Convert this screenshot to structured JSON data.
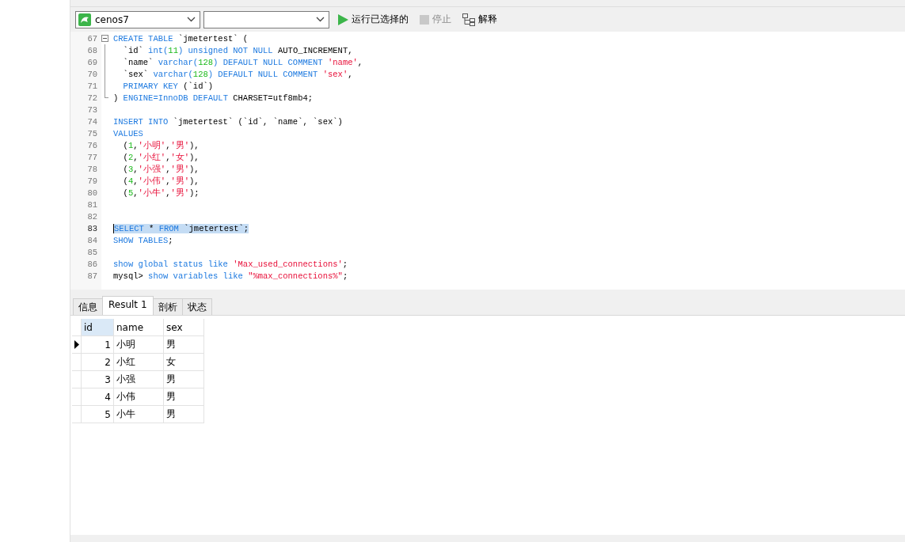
{
  "toolbar": {
    "connection": {
      "value": "cenos7"
    },
    "buttons": [
      {
        "kind": "run",
        "label": "运行已选择的",
        "disabled": false
      },
      {
        "kind": "stop",
        "label": "停止",
        "disabled": true
      },
      {
        "kind": "explain",
        "label": "解释",
        "disabled": false
      }
    ]
  },
  "editor": {
    "lines": [
      {
        "number": "67",
        "kind": "fold_start",
        "selected": false,
        "tokens": [
          {
            "kind": "kw",
            "text": "CREATE TABLE"
          },
          {
            "kind": "plain",
            "text": " `jmetertest` ("
          }
        ]
      },
      {
        "number": "68",
        "kind": "fold_body",
        "selected": false,
        "tokens": [
          {
            "kind": "plain",
            "text": "  `id` "
          },
          {
            "kind": "kw",
            "text": "int("
          },
          {
            "kind": "num",
            "text": "11"
          },
          {
            "kind": "kw",
            "text": ") unsigned NOT NULL"
          },
          {
            "kind": "plain",
            "text": " AUTO_INCREMENT,"
          }
        ]
      },
      {
        "number": "69",
        "kind": "fold_body",
        "selected": false,
        "tokens": [
          {
            "kind": "plain",
            "text": "  `name` "
          },
          {
            "kind": "kw",
            "text": "varchar("
          },
          {
            "kind": "num",
            "text": "128"
          },
          {
            "kind": "kw",
            "text": ") DEFAULT NULL COMMENT "
          },
          {
            "kind": "str",
            "text": "'name'"
          },
          {
            "kind": "plain",
            "text": ","
          }
        ]
      },
      {
        "number": "70",
        "kind": "fold_body",
        "selected": false,
        "tokens": [
          {
            "kind": "plain",
            "text": "  `sex` "
          },
          {
            "kind": "kw",
            "text": "varchar("
          },
          {
            "kind": "num",
            "text": "128"
          },
          {
            "kind": "kw",
            "text": ") DEFAULT NULL COMMENT "
          },
          {
            "kind": "str",
            "text": "'sex'"
          },
          {
            "kind": "plain",
            "text": ","
          }
        ]
      },
      {
        "number": "71",
        "kind": "fold_body",
        "selected": false,
        "tokens": [
          {
            "kind": "kw",
            "text": "  PRIMARY KEY"
          },
          {
            "kind": "plain",
            "text": " (`id`)"
          }
        ]
      },
      {
        "number": "72",
        "kind": "fold_end",
        "selected": false,
        "tokens": [
          {
            "kind": "plain",
            "text": ") "
          },
          {
            "kind": "kw",
            "text": "ENGINE=InnoDB DEFAULT"
          },
          {
            "kind": "plain",
            "text": " CHARSET=utf8mb4;"
          }
        ]
      },
      {
        "number": "73",
        "kind": "plain",
        "selected": false
      },
      {
        "number": "74",
        "kind": "plain",
        "selected": false,
        "tokens": [
          {
            "kind": "kw",
            "text": "INSERT INTO"
          },
          {
            "kind": "plain",
            "text": " `jmetertest` (`id`, `name`, `sex`)"
          }
        ]
      },
      {
        "number": "75",
        "kind": "plain",
        "selected": false,
        "tokens": [
          {
            "kind": "kw",
            "text": "VALUES"
          }
        ]
      },
      {
        "number": "76",
        "kind": "plain",
        "selected": false,
        "tokens": [
          {
            "kind": "plain",
            "text": "  ("
          },
          {
            "kind": "num",
            "text": "1"
          },
          {
            "kind": "plain",
            "text": ","
          },
          {
            "kind": "str",
            "text": "'小明'"
          },
          {
            "kind": "plain",
            "text": ","
          },
          {
            "kind": "str",
            "text": "'男'"
          },
          {
            "kind": "plain",
            "text": "),"
          }
        ]
      },
      {
        "number": "77",
        "kind": "plain",
        "selected": false,
        "tokens": [
          {
            "kind": "plain",
            "text": "  ("
          },
          {
            "kind": "num",
            "text": "2"
          },
          {
            "kind": "plain",
            "text": ","
          },
          {
            "kind": "str",
            "text": "'小红'"
          },
          {
            "kind": "plain",
            "text": ","
          },
          {
            "kind": "str",
            "text": "'女'"
          },
          {
            "kind": "plain",
            "text": "),"
          }
        ]
      },
      {
        "number": "78",
        "kind": "plain",
        "selected": false,
        "tokens": [
          {
            "kind": "plain",
            "text": "  ("
          },
          {
            "kind": "num",
            "text": "3"
          },
          {
            "kind": "plain",
            "text": ","
          },
          {
            "kind": "str",
            "text": "'小强'"
          },
          {
            "kind": "plain",
            "text": ","
          },
          {
            "kind": "str",
            "text": "'男'"
          },
          {
            "kind": "plain",
            "text": "),"
          }
        ]
      },
      {
        "number": "79",
        "kind": "plain",
        "selected": false,
        "tokens": [
          {
            "kind": "plain",
            "text": "  ("
          },
          {
            "kind": "num",
            "text": "4"
          },
          {
            "kind": "plain",
            "text": ","
          },
          {
            "kind": "str",
            "text": "'小伟'"
          },
          {
            "kind": "plain",
            "text": ","
          },
          {
            "kind": "str",
            "text": "'男'"
          },
          {
            "kind": "plain",
            "text": "),"
          }
        ]
      },
      {
        "number": "80",
        "kind": "plain",
        "selected": false,
        "tokens": [
          {
            "kind": "plain",
            "text": "  ("
          },
          {
            "kind": "num",
            "text": "5"
          },
          {
            "kind": "plain",
            "text": ","
          },
          {
            "kind": "str",
            "text": "'小牛'"
          },
          {
            "kind": "plain",
            "text": ","
          },
          {
            "kind": "str",
            "text": "'男'"
          },
          {
            "kind": "plain",
            "text": ");"
          }
        ]
      },
      {
        "number": "81",
        "kind": "plain",
        "selected": false
      },
      {
        "number": "82",
        "kind": "plain",
        "selected": false
      },
      {
        "number": "83",
        "kind": "plain",
        "selected": true,
        "tokens": [
          {
            "kind": "kw",
            "text": "SELECT"
          },
          {
            "kind": "plain",
            "text": " * "
          },
          {
            "kind": "kw",
            "text": "FROM"
          },
          {
            "kind": "plain",
            "text": " `jmetertest`;"
          }
        ]
      },
      {
        "number": "84",
        "kind": "plain",
        "selected": false,
        "tokens": [
          {
            "kind": "kw",
            "text": "SHOW TABLES"
          },
          {
            "kind": "plain",
            "text": ";"
          }
        ]
      },
      {
        "number": "85",
        "kind": "plain",
        "selected": false
      },
      {
        "number": "86",
        "kind": "plain",
        "selected": false,
        "tokens": [
          {
            "kind": "kw",
            "text": "show global status like "
          },
          {
            "kind": "str",
            "text": "'Max_used_connections'"
          },
          {
            "kind": "plain",
            "text": ";"
          }
        ]
      },
      {
        "number": "87",
        "kind": "plain",
        "selected": false,
        "tokens": [
          {
            "kind": "plain",
            "text": "mysql> "
          },
          {
            "kind": "kw",
            "text": "show variables like "
          },
          {
            "kind": "str",
            "text": "\"%max_connections%\""
          },
          {
            "kind": "plain",
            "text": ";"
          }
        ]
      }
    ]
  },
  "result_tabs": [
    {
      "label": "信息",
      "selected": false
    },
    {
      "label": "Result 1",
      "selected": true
    },
    {
      "label": "剖析",
      "selected": false
    },
    {
      "label": "状态",
      "selected": false
    }
  ],
  "table": {
    "columns": [
      {
        "label": "id",
        "selected": true
      },
      {
        "label": "name",
        "selected": false
      },
      {
        "label": "sex",
        "selected": false
      }
    ],
    "rows": [
      {
        "current": true,
        "cells": [
          "1",
          "小明",
          "男"
        ]
      },
      {
        "current": false,
        "cells": [
          "2",
          "小红",
          "女"
        ]
      },
      {
        "current": false,
        "cells": [
          "3",
          "小强",
          "男"
        ]
      },
      {
        "current": false,
        "cells": [
          "4",
          "小伟",
          "男"
        ]
      },
      {
        "current": false,
        "cells": [
          "5",
          "小牛",
          "男"
        ]
      }
    ]
  }
}
